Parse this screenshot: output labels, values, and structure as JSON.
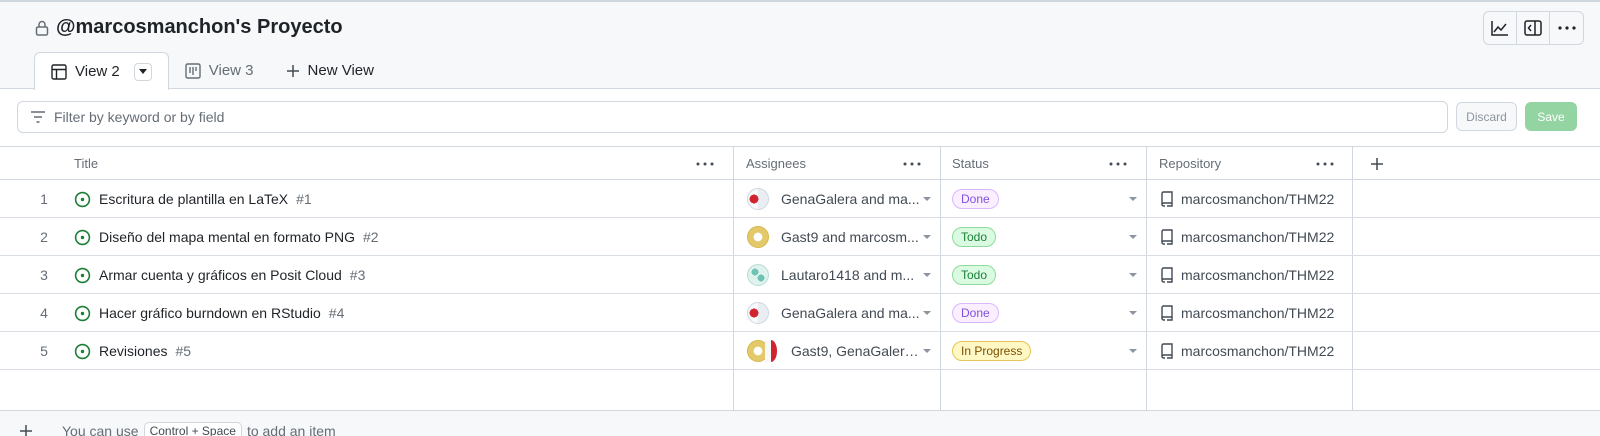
{
  "header": {
    "title": "@marcosmanchon's Proyecto",
    "tools": [
      "insights-icon",
      "side-panel-icon",
      "more-options-icon"
    ]
  },
  "tabs": [
    {
      "label": "View 2",
      "icon": "table-icon",
      "active": true
    },
    {
      "label": "View 3",
      "icon": "board-icon",
      "active": false
    },
    {
      "label": "New View",
      "icon": "plus-icon",
      "active": false
    }
  ],
  "filter": {
    "placeholder": "Filter by keyword or by field",
    "discard_label": "Discard",
    "save_label": "Save"
  },
  "table": {
    "columns": [
      "Title",
      "Assignees",
      "Status",
      "Repository"
    ],
    "rows": [
      {
        "num": "1",
        "title": "Escritura de plantilla en LaTeX",
        "issue": "#1",
        "assignees": "GenaGalera and ma...",
        "status": "Done",
        "repo": "marcosmanchon/THM22"
      },
      {
        "num": "2",
        "title": "Diseño del mapa mental en formato PNG",
        "issue": "#2",
        "assignees": "Gast9 and marcosm...",
        "status": "Todo",
        "repo": "marcosmanchon/THM22"
      },
      {
        "num": "3",
        "title": "Armar cuenta y gráficos en Posit Cloud",
        "issue": "#3",
        "assignees": "Lautaro1418 and m...",
        "status": "Todo",
        "repo": "marcosmanchon/THM22"
      },
      {
        "num": "4",
        "title": "Hacer gráfico burndown en RStudio",
        "issue": "#4",
        "assignees": "GenaGalera and ma...",
        "status": "Done",
        "repo": "marcosmanchon/THM22"
      },
      {
        "num": "5",
        "title": "Revisiones",
        "issue": "#5",
        "assignees": "Gast9, GenaGalera...",
        "status": "In Progress",
        "repo": "marcosmanchon/THM22"
      }
    ],
    "add_item": {
      "prefix": "You can use",
      "shortcut": "Control + Space",
      "suffix": "to add an item"
    }
  },
  "colors": {
    "open_issue": "#1a7f37",
    "done": "#8250df",
    "todo": "#1a7f37",
    "in_progress": "#9a6700",
    "save_button": "#94d3a2"
  }
}
